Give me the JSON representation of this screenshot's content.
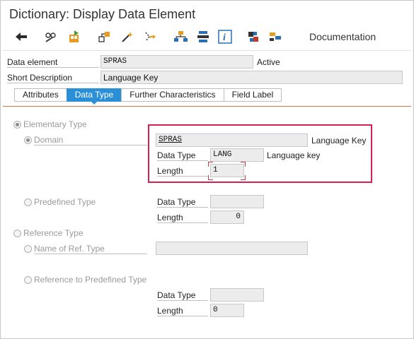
{
  "window": {
    "title": "Dictionary: Display Data Element"
  },
  "toolbar": {
    "icons": [
      "back-icon",
      "display-change-icon",
      "activate-icon",
      "where-used-icon",
      "magic-wand-icon",
      "navigate-icon",
      "hierarchy-icon",
      "stack-icon",
      "info-icon",
      "tools-icon",
      "module-icon"
    ],
    "documentation_label": "Documentation"
  },
  "header": {
    "data_element_label": "Data element",
    "data_element_value": "SPRAS",
    "status": "Active",
    "short_desc_label": "Short Description",
    "short_desc_value": "Language Key"
  },
  "tabs": [
    {
      "label": "Attributes",
      "active": false
    },
    {
      "label": "Data Type",
      "active": true
    },
    {
      "label": "Further Characteristics",
      "active": false
    },
    {
      "label": "Field Label",
      "active": false
    }
  ],
  "data_type": {
    "elementary_label": "Elementary Type",
    "domain_label": "Domain",
    "domain_value": "SPRAS",
    "domain_desc": "Language Key",
    "data_type_label": "Data Type",
    "domain_data_type_value": "LANG",
    "domain_data_type_desc": "Language key",
    "length_label": "Length",
    "domain_length_value": "1",
    "predefined_label": "Predefined Type",
    "predef_data_type_label": "Data Type",
    "predef_data_type_value": "",
    "predef_length_label": "Length",
    "predef_length_value": "0",
    "reference_label": "Reference Type",
    "ref_name_label": "Name of Ref. Type",
    "ref_name_value": "",
    "ref_predef_label": "Reference to Predefined Type",
    "ref_data_type_label": "Data Type",
    "ref_data_type_value": "",
    "ref_length_label": "Length",
    "ref_length_value": "0"
  },
  "colors": {
    "accent": "#2b8fd8",
    "highlight": "#d6204f",
    "tab_line": "#e26f3a"
  }
}
